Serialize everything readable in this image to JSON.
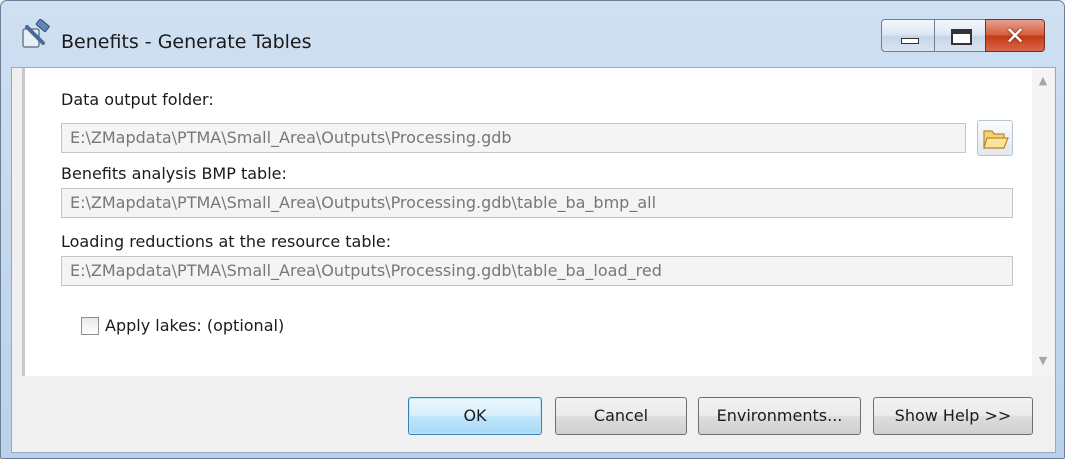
{
  "window": {
    "title": "Benefits - Generate Tables",
    "controls": {
      "minimize": "minimize",
      "maximize": "maximize",
      "close": "✕"
    }
  },
  "form": {
    "output_folder": {
      "label": "Data output folder:",
      "value": "E:\\ZMapdata\\PTMA\\Small_Area\\Outputs\\Processing.gdb"
    },
    "bmp_table": {
      "label": "Benefits analysis BMP table:",
      "value": "E:\\ZMapdata\\PTMA\\Small_Area\\Outputs\\Processing.gdb\\table_ba_bmp_all"
    },
    "load_red_table": {
      "label": "Loading reductions at the resource table:",
      "value": "E:\\ZMapdata\\PTMA\\Small_Area\\Outputs\\Processing.gdb\\table_ba_load_red"
    },
    "apply_lakes": {
      "label": "Apply lakes: (optional)",
      "checked": false
    }
  },
  "scrollbar": {
    "up_glyph": "▲",
    "down_glyph": "▼"
  },
  "buttons": {
    "ok": "OK",
    "cancel": "Cancel",
    "environments": "Environments...",
    "show_help": "Show Help >>"
  },
  "icons": {
    "app": "toolbox-hammer-icon",
    "browse": "folder-open-icon"
  },
  "colors": {
    "title_bar": "#c4d8ee",
    "close_button": "#c63a18",
    "default_button_border": "#3c7fb1"
  }
}
